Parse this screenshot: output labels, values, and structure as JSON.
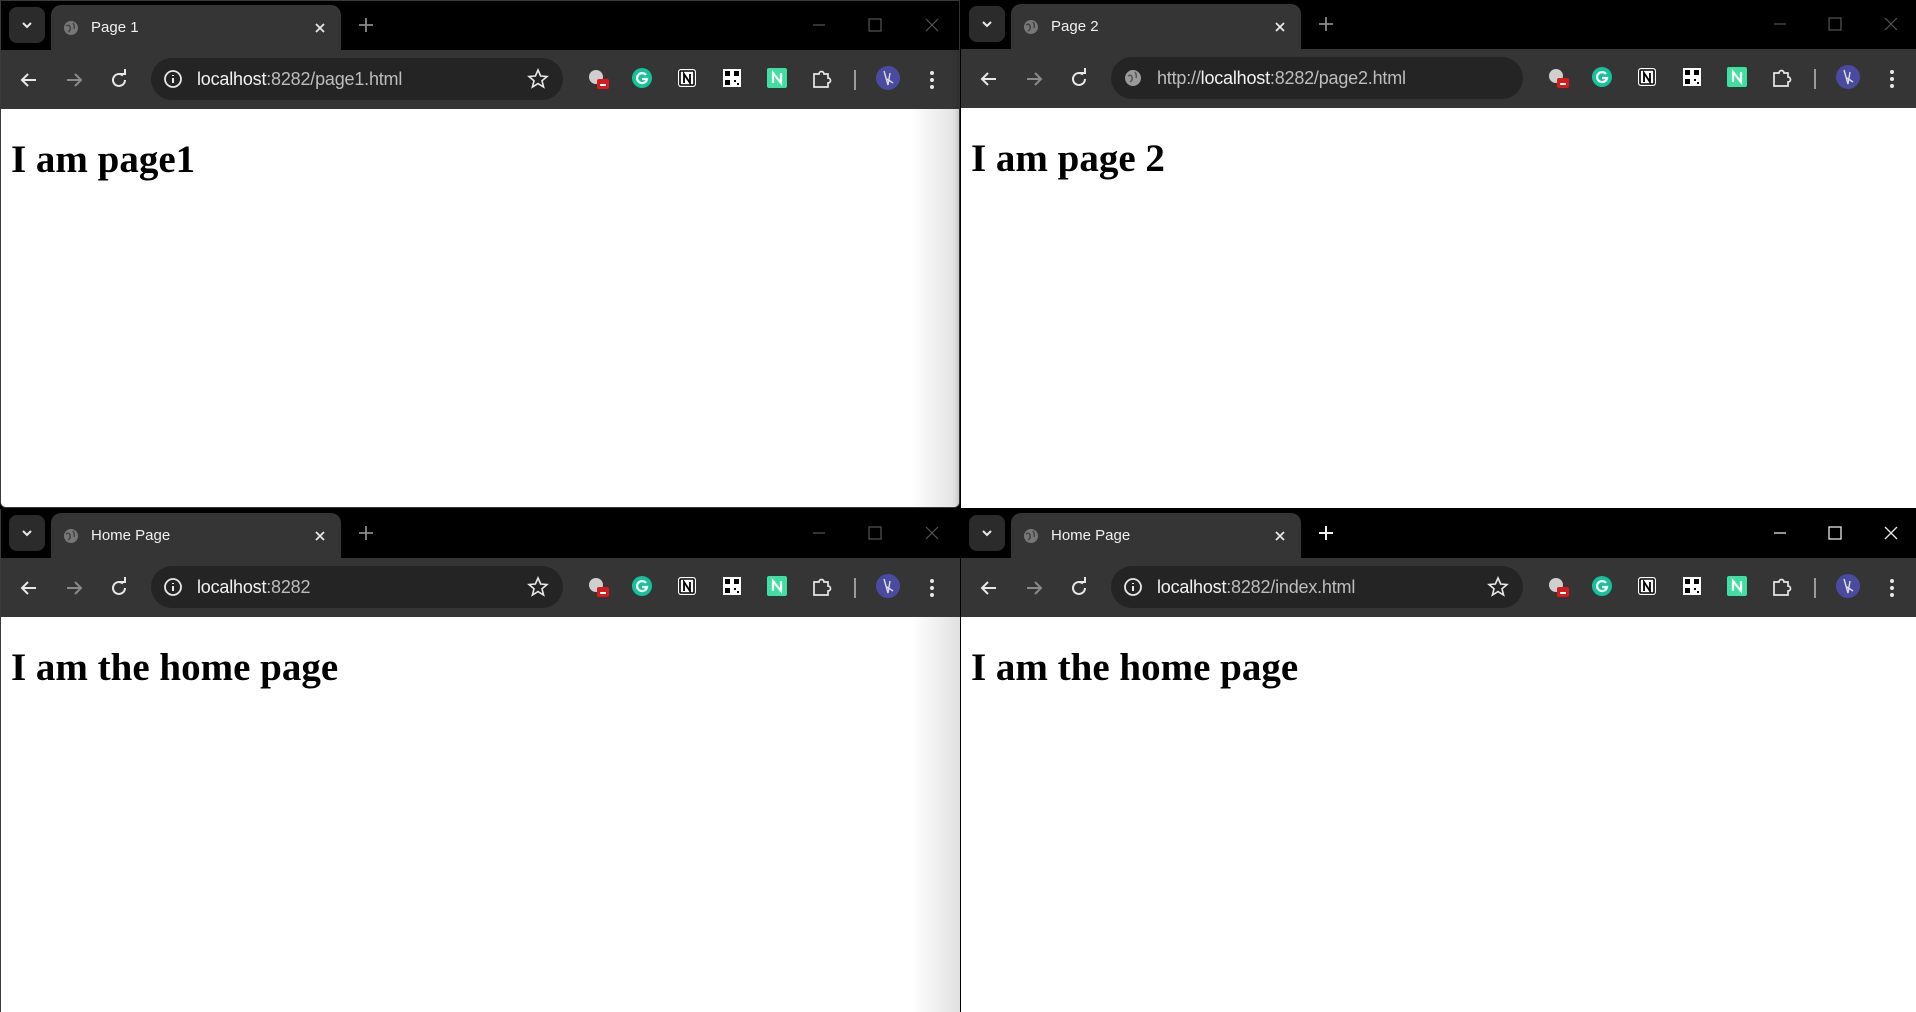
{
  "windows": [
    {
      "id": "win-1",
      "tab_title": "Page 1",
      "url_host": "localhost",
      "url_rest": ":8282/page1.html",
      "heading": "I am page1",
      "active": false
    },
    {
      "id": "win-2",
      "tab_title": "Page 2",
      "url_prefix": "http://",
      "url_host": "localhost",
      "url_rest": ":8282/page2.html",
      "heading": "I am page 2",
      "active": false
    },
    {
      "id": "win-3",
      "tab_title": "Home Page",
      "url_host": "localhost",
      "url_rest": ":8282",
      "heading": "I am the home page",
      "active": false
    },
    {
      "id": "win-4",
      "tab_title": "Home Page",
      "url_host": "localhost",
      "url_rest": ":8282/index.html",
      "heading": "I am the home page",
      "active": true
    }
  ],
  "colors": {
    "tabstrip": "#000000",
    "toolbar": "#353535",
    "omnibox": "#242424",
    "grammarly": "#15c39a",
    "notion_badge": "#3ee0a1",
    "error_badge": "#d91a1a"
  },
  "icons": {
    "tab_search": "chevron-down-icon",
    "favicon": "globe-icon",
    "close": "close-icon",
    "new_tab": "plus-icon",
    "back": "arrow-left-icon",
    "forward": "arrow-right-icon",
    "reload": "reload-icon",
    "info": "info-icon",
    "star": "star-icon",
    "extensions": "puzzle-icon",
    "menu": "kebab-menu-icon"
  }
}
